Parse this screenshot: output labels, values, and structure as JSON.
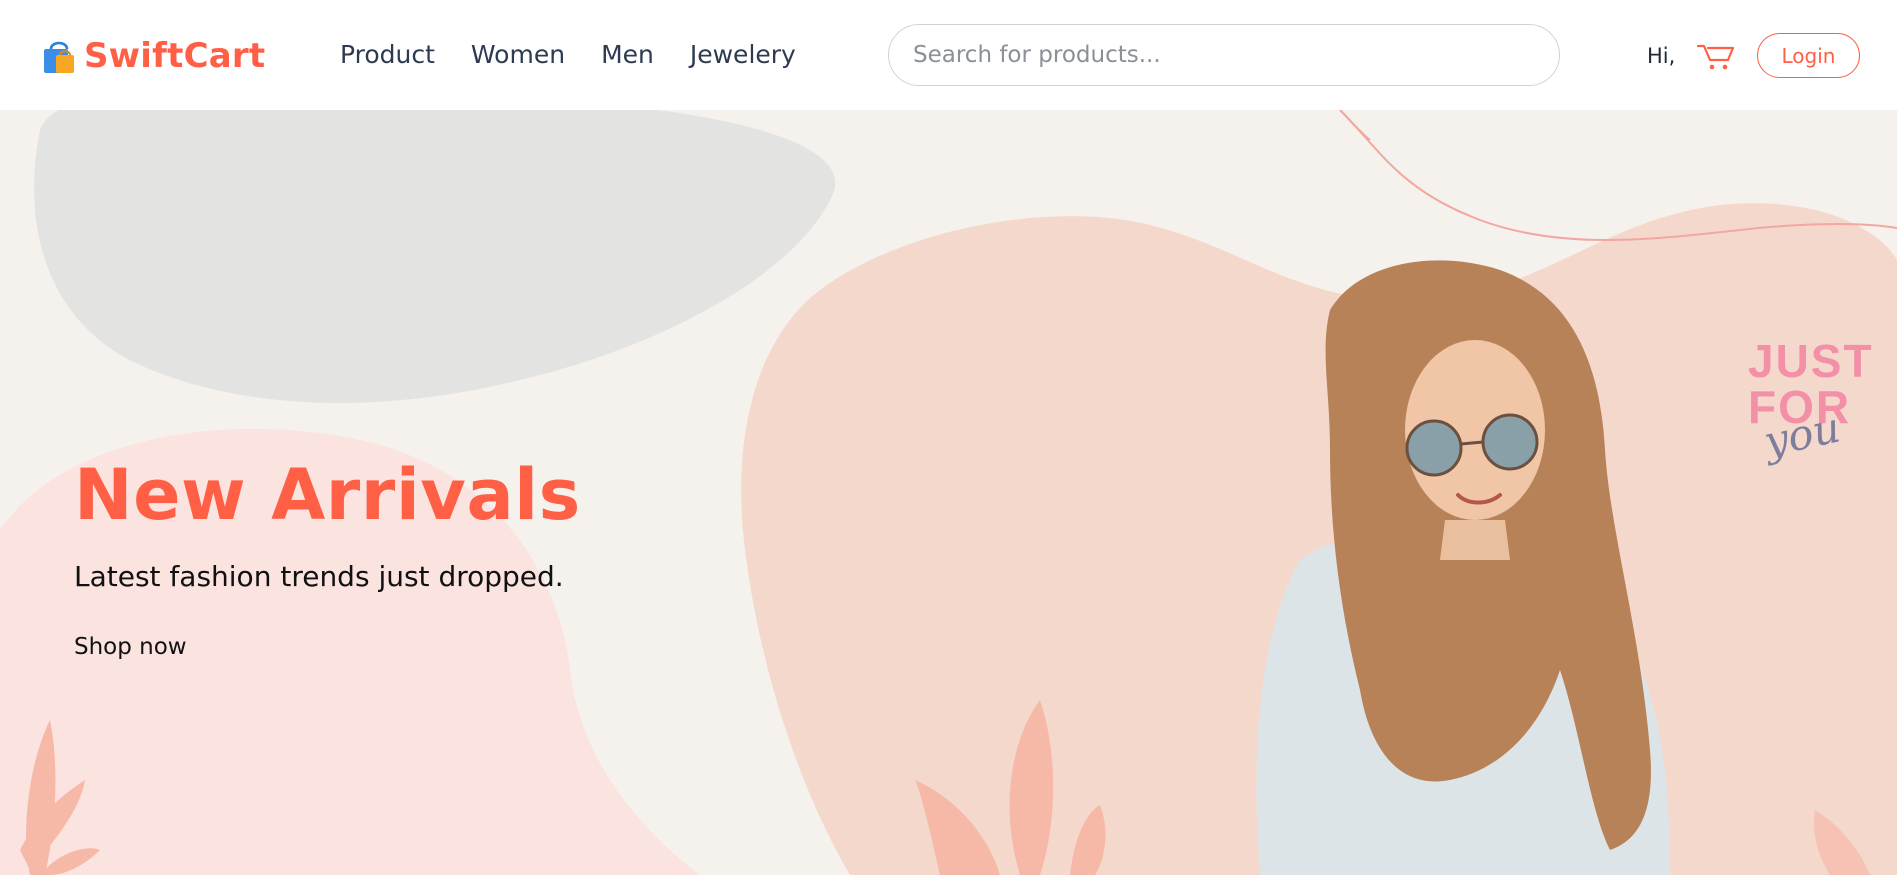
{
  "brand": {
    "name": "SwiftCart",
    "icon": "shopping-bag-icon"
  },
  "nav": {
    "items": [
      "Product",
      "Women",
      "Men",
      "Jewelery"
    ]
  },
  "search": {
    "placeholder": "Search for products..."
  },
  "user": {
    "greeting": "Hi,",
    "cart_icon": "cart-icon",
    "login_label": "Login"
  },
  "hero": {
    "title": "New Arrivals",
    "subtitle": "Latest fashion trends just dropped.",
    "cta_label": "Shop now",
    "promo_line1": "JUST",
    "promo_line2": "FOR",
    "promo_script": "you"
  },
  "colors": {
    "accent": "#ff5f45",
    "nav_text": "#2d3a52",
    "hero_bg": "#f5f1ed",
    "blob_gray": "#e3e4e1",
    "blob_peach": "#f5d8cc",
    "blob_pink": "#fbe3e0"
  }
}
